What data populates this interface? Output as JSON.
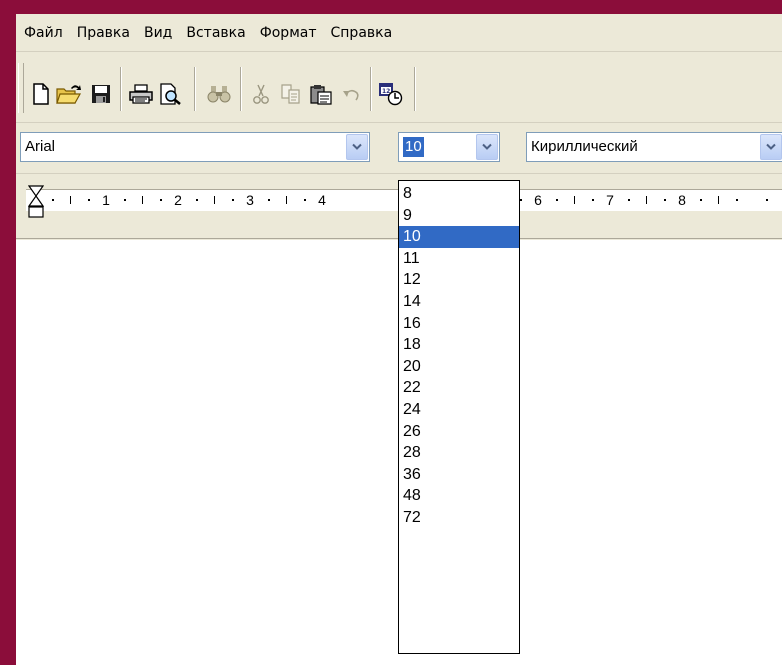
{
  "menu": [
    "Файл",
    "Правка",
    "Вид",
    "Вставка",
    "Формат",
    "Справка"
  ],
  "toolbar": {
    "buttons": [
      {
        "name": "new-document",
        "icon": "new-document-icon"
      },
      {
        "name": "open",
        "icon": "open-folder-icon"
      },
      {
        "name": "save",
        "icon": "save-disk-icon"
      },
      {
        "name": "print",
        "icon": "printer-icon"
      },
      {
        "name": "print-preview",
        "icon": "print-preview-icon"
      },
      {
        "name": "find",
        "icon": "binoculars-icon"
      },
      {
        "name": "cut",
        "icon": "scissors-icon"
      },
      {
        "name": "copy",
        "icon": "copy-icon"
      },
      {
        "name": "paste",
        "icon": "paste-clipboard-icon"
      },
      {
        "name": "undo",
        "icon": "undo-arrow-icon"
      },
      {
        "name": "date-time",
        "icon": "date-time-icon"
      }
    ]
  },
  "format": {
    "font": "Arial",
    "size": "10",
    "script": "Кириллический"
  },
  "ruler": {
    "numbers": [
      "1",
      "2",
      "3",
      "4",
      "6",
      "7",
      "8"
    ]
  },
  "dropdown": {
    "options": [
      "8",
      "9",
      "10",
      "11",
      "12",
      "14",
      "16",
      "18",
      "20",
      "22",
      "24",
      "26",
      "28",
      "36",
      "48",
      "72"
    ],
    "selected": "10"
  },
  "colors": {
    "frame": "#8b0d3a",
    "chrome": "#ece9d8",
    "selection": "#316ac5"
  }
}
